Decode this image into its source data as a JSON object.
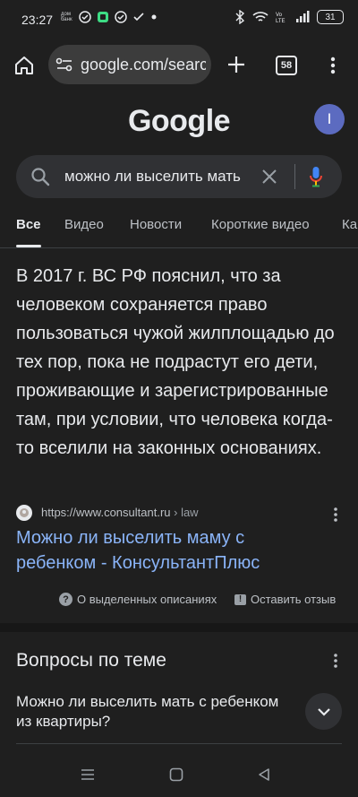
{
  "status_bar": {
    "time": "23:27",
    "mini_label": "дом банк",
    "battery": "31"
  },
  "browser": {
    "url": "google.com/search",
    "tabs_count": "58"
  },
  "google": {
    "logo": "Google",
    "avatar_letter": "I",
    "search_query": "можно ли выселить мать"
  },
  "tabs": [
    {
      "label": "Все"
    },
    {
      "label": "Видео"
    },
    {
      "label": "Новости"
    },
    {
      "label": "Короткие видео"
    },
    {
      "label": "Ка"
    }
  ],
  "snippet": {
    "text": "В 2017 г. ВС РФ пояснил, что за человеком сохраняется право пользоваться чужой жилплощадью до тех пор, пока не подрастут его дети, проживающие и зарегистрированные там, при условии, что человека когда-то вселили на законных основаниях.",
    "source_url": "https://www.consultant.ru",
    "source_path": " › law",
    "result_title": "Можно ли выселить маму с ребенком - КонсультантПлюс",
    "about_label": "О выделенных описаниях",
    "feedback_label": "Оставить отзыв"
  },
  "related": {
    "title": "Вопросы по теме",
    "question": "Можно ли выселить мать с ребенком из квартиры?"
  },
  "colors": {
    "background": "#1f1f1f",
    "link": "#8ab4f8",
    "avatar": "#5c6bc0"
  }
}
